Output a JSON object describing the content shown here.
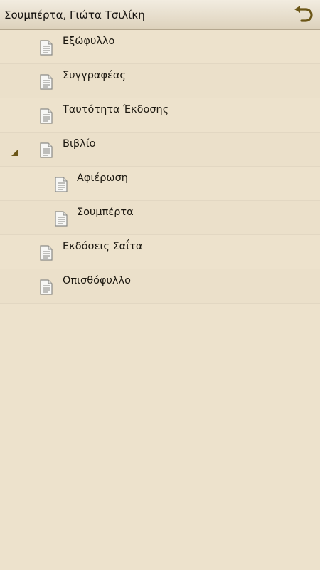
{
  "header": {
    "title": "Σουμπέρτα, Γιώτα Τσιλίκη",
    "back_icon": "undo-arrow-icon"
  },
  "colors": {
    "background": "#ede2cc",
    "header_top": "#f2ece0",
    "header_bottom": "#ddd2bc",
    "accent": "#6b5617"
  },
  "toc": {
    "items": [
      {
        "label": "Εξώφυλλο",
        "icon": "document-icon"
      },
      {
        "label": "Συγγραφέας",
        "icon": "document-icon"
      },
      {
        "label": "Ταυτότητα Έκδοσης",
        "icon": "document-icon"
      },
      {
        "label": "Βιβλίο",
        "icon": "document-icon",
        "expanded": true
      },
      {
        "label": "Αφιέρωση",
        "icon": "document-icon"
      },
      {
        "label": "Σουμπέρτα",
        "icon": "document-icon"
      },
      {
        "label": "Εκδόσεις Σαΐτα",
        "icon": "document-icon"
      },
      {
        "label": "Οπισθόφυλλο",
        "icon": "document-icon"
      }
    ]
  }
}
